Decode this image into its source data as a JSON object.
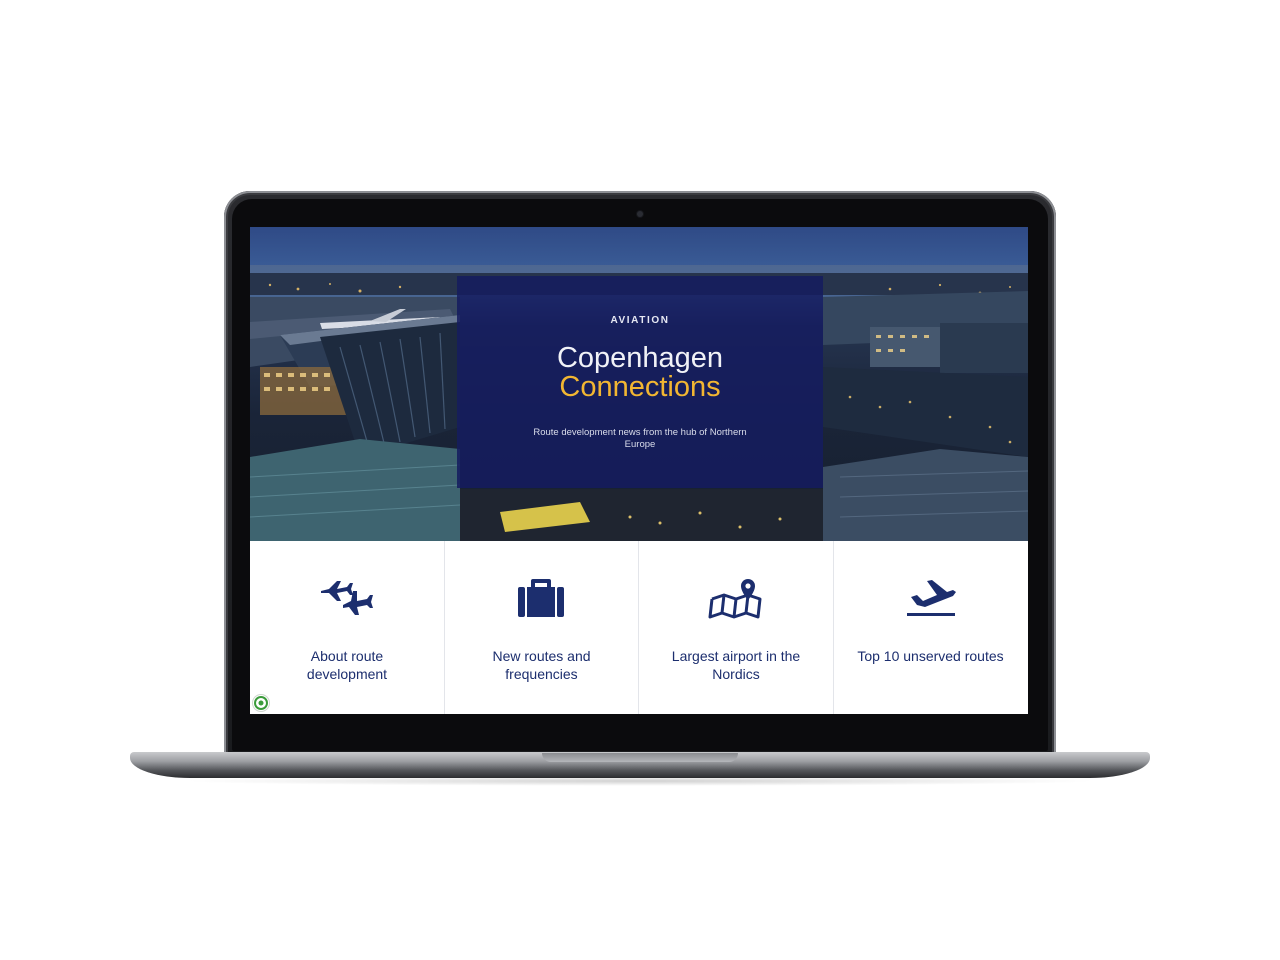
{
  "hero": {
    "kicker": "AVIATION",
    "title_line1": "Copenhagen",
    "title_line2": "Connections",
    "subtitle": "Route development news from the hub of Northern Europe"
  },
  "tiles": [
    {
      "label": "About route development",
      "icon": "planes-icon"
    },
    {
      "label": "New routes and frequencies",
      "icon": "suitcase-icon"
    },
    {
      "label": "Largest airport in the Nordics",
      "icon": "map-pin-icon"
    },
    {
      "label": "Top 10 unserved routes",
      "icon": "departure-icon"
    }
  ],
  "colors": {
    "brand_navy": "#1c2e6e",
    "card_overlay": "#151c60",
    "accent_gold": "#f2b632"
  }
}
